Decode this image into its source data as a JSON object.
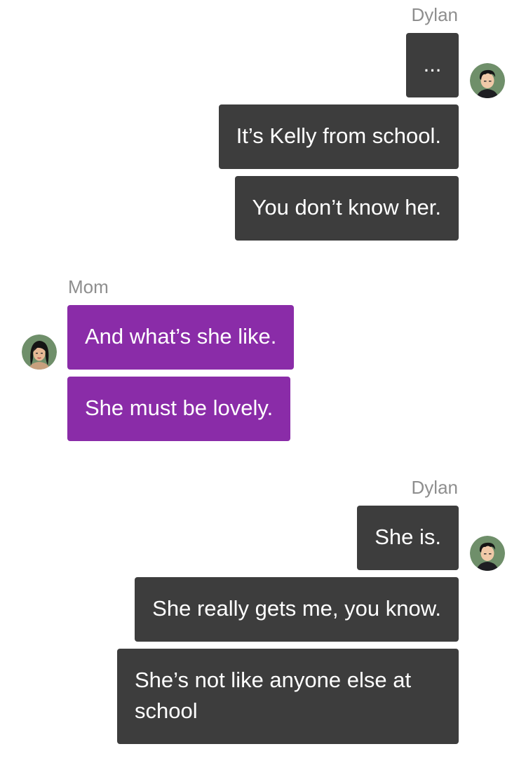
{
  "conversation": {
    "groups": [
      {
        "sender": "Dylan",
        "side": "right",
        "messages": [
          "...",
          "It’s Kelly from school.",
          "You don’t know her."
        ]
      },
      {
        "sender": "Mom",
        "side": "left",
        "messages": [
          "And what’s she like.",
          "She must be lovely."
        ]
      },
      {
        "sender": "Dylan",
        "side": "right",
        "messages": [
          "She is.",
          "She really gets me, you know.",
          "She’s not like anyone else at school"
        ]
      }
    ]
  },
  "colors": {
    "dylan_bubble": "#3d3d3d",
    "mom_bubble": "#8a2ca8",
    "sender_name": "#8e8e8e",
    "background": "#ffffff"
  },
  "icons": {
    "dylan_avatar": "dylan-avatar-icon",
    "mom_avatar": "mom-avatar-icon"
  }
}
